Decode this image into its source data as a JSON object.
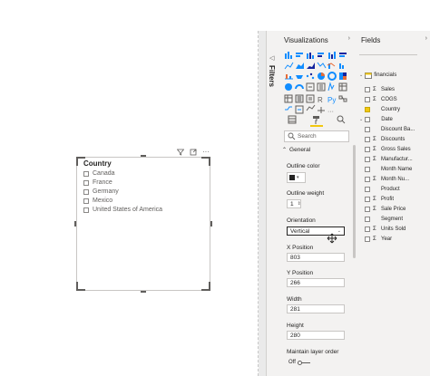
{
  "filters_pane": {
    "label": "Filters"
  },
  "slicer": {
    "title": "Country",
    "items": [
      "Canada",
      "France",
      "Germany",
      "Mexico",
      "United States of America"
    ]
  },
  "visualizations": {
    "title": "Visualizations",
    "search_placeholder": "Search",
    "section": "General",
    "outline_color_label": "Outline color",
    "outline_weight_label": "Outline weight",
    "outline_weight_value": "1",
    "orientation_label": "Orientation",
    "orientation_value": "Vertical",
    "x_label": "X Position",
    "x_value": "803",
    "y_label": "Y Position",
    "y_value": "266",
    "width_label": "Width",
    "width_value": "281",
    "height_label": "Height",
    "height_value": "280",
    "maintain_label": "Maintain layer order",
    "toggle_label": "Off"
  },
  "fields": {
    "title": "Fields",
    "table_name": "financials",
    "items": [
      {
        "name": "Sales",
        "sigma": true,
        "checked": false
      },
      {
        "name": "COGS",
        "sigma": true,
        "checked": false
      },
      {
        "name": "Country",
        "sigma": false,
        "checked": true
      },
      {
        "name": "Date",
        "sigma": false,
        "checked": false,
        "expandable": true
      },
      {
        "name": "Discount Ba...",
        "sigma": false,
        "checked": false
      },
      {
        "name": "Discounts",
        "sigma": true,
        "checked": false
      },
      {
        "name": "Gross Sales",
        "sigma": true,
        "checked": false
      },
      {
        "name": "Manufactur...",
        "sigma": true,
        "checked": false
      },
      {
        "name": "Month Name",
        "sigma": false,
        "checked": false
      },
      {
        "name": "Month Nu...",
        "sigma": true,
        "checked": false
      },
      {
        "name": "Product",
        "sigma": false,
        "checked": false
      },
      {
        "name": "Profit",
        "sigma": true,
        "checked": false
      },
      {
        "name": "Sale Price",
        "sigma": true,
        "checked": false
      },
      {
        "name": "Segment",
        "sigma": false,
        "checked": false
      },
      {
        "name": "Units Sold",
        "sigma": true,
        "checked": false
      },
      {
        "name": "Year",
        "sigma": true,
        "checked": false
      }
    ]
  }
}
